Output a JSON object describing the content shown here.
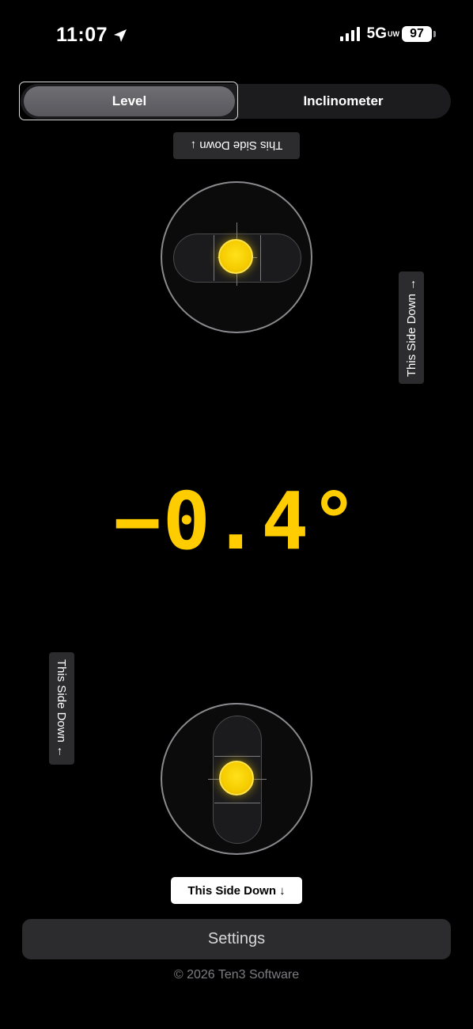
{
  "status_bar": {
    "time": "11:07",
    "network": "5G",
    "network_suffix": "UW",
    "battery": "97",
    "icons": [
      "location-arrow-icon",
      "signal-bars-icon",
      "battery-icon"
    ]
  },
  "tabs": [
    {
      "label": "Level",
      "selected": true
    },
    {
      "label": "Inclinometer",
      "selected": false
    }
  ],
  "side_down": {
    "top": "This Side Down ↓",
    "right": "This Side Down →",
    "left": "This Side Down ←",
    "bottom": "This Side Down ↓"
  },
  "reading": "−0.4°",
  "settings_label": "Settings",
  "copyright": "© 2026 Ten3 Software",
  "colors": {
    "accent": "#ffcc00",
    "background": "#000000",
    "control": "#2c2c2e"
  }
}
